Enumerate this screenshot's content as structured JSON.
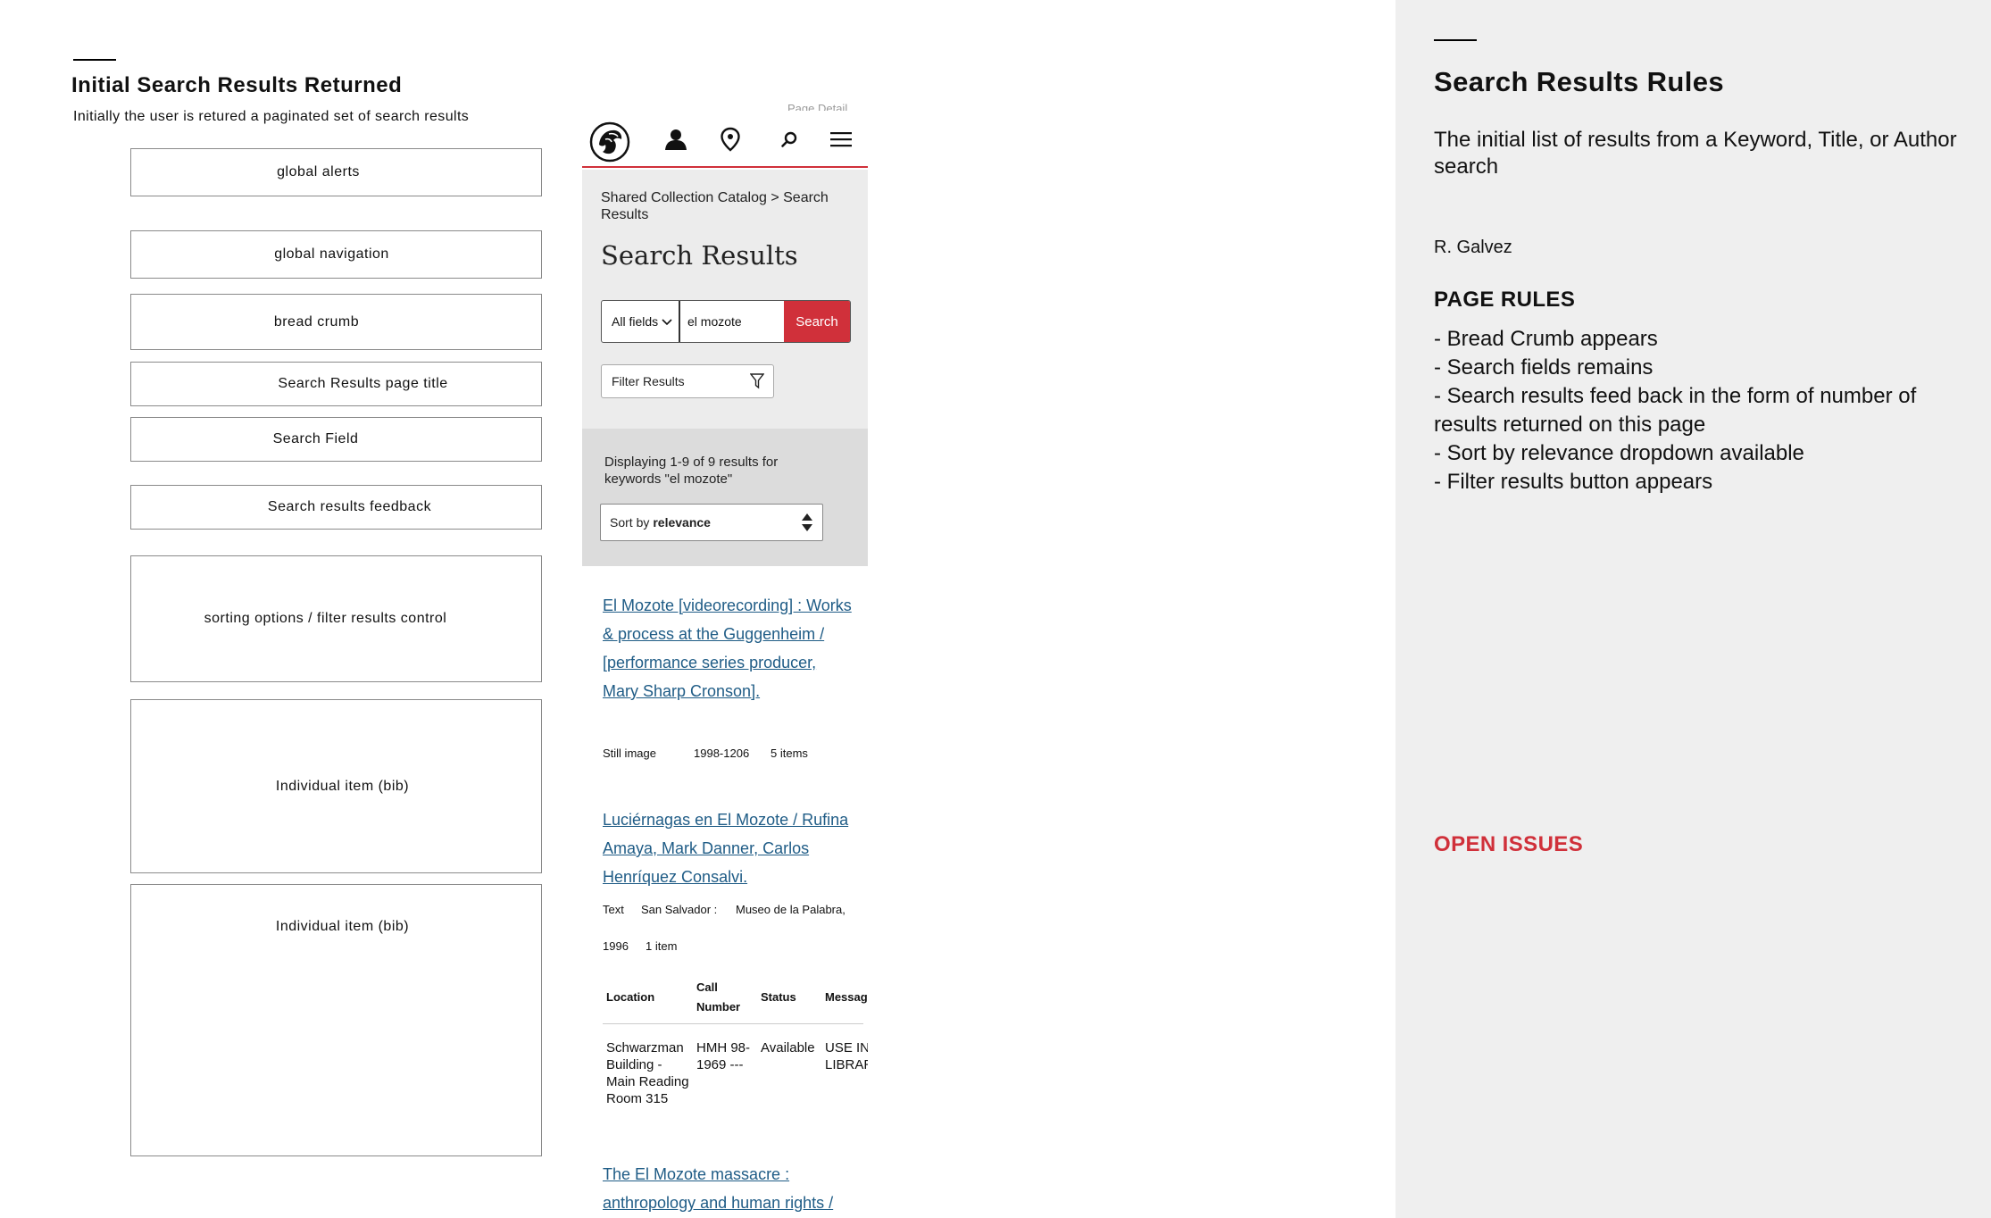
{
  "wireframe": {
    "title": "Initial Search Results Returned",
    "subtitle": "Initially the user is retured a paginated set of search results",
    "boxes": [
      "global alerts",
      "global navigation",
      "bread crumb",
      "Search Results page title",
      "Search Field",
      "Search results feedback",
      "sorting options / filter results control",
      "Individual item (bib)",
      "Individual item (bib)"
    ]
  },
  "mock": {
    "page_detail": "Page Detail",
    "header_icons": [
      "lion-logo-icon",
      "user-icon",
      "location-pin-icon",
      "search-icon",
      "menu-icon"
    ],
    "breadcrumb": "Shared Collection Catalog > Search Results",
    "page_title": "Search Results",
    "search": {
      "field_select": "All fields",
      "query": "el mozote",
      "button": "Search"
    },
    "filter_button": "Filter Results",
    "feedback": "Displaying 1-9 of 9 results for keywords \"el mozote\"",
    "sort": {
      "prefix": "Sort by",
      "value": "relevance"
    },
    "results": [
      {
        "title": "El Mozote [videorecording] : Works & process at the Guggenheim / [performance series producer, Mary Sharp Cronson].",
        "type": "Still image",
        "date": "1998-1206",
        "items": "5 items"
      },
      {
        "title": "Luciérnagas en El Mozote / Rufina Amaya, Mark Danner, Carlos Henríquez Consalvi.",
        "type": "Text",
        "place": "San Salvador :",
        "publisher": "Museo de la Palabra,",
        "date": "1996",
        "items": "1 item",
        "table": {
          "headers": [
            "Location",
            "Call Number",
            "Status",
            "Message"
          ],
          "row": [
            "Schwarzman Building - Main Reading Room 315",
            "HMH 98-1969 ---",
            "Available",
            "USE IN LIBRARY"
          ]
        }
      },
      {
        "title": "The El Mozote massacre : anthropology and human rights /"
      }
    ]
  },
  "panel": {
    "title": "Search Results Rules",
    "description": "The initial list of results from a Keyword, Title, or Author search",
    "author": "R. Galvez",
    "page_rules_heading": "PAGE RULES",
    "rules": [
      "- Bread Crumb appears",
      "- Search fields remains",
      "- Search results feed back in the form of number of results returned on this page",
      "- Sort by relevance dropdown available",
      "- Filter results button appears"
    ],
    "open_issues_heading": "OPEN ISSUES"
  },
  "colors": {
    "brand_red": "#d0303a",
    "link_blue": "#1f5c86",
    "panel_bg": "#efefef",
    "mock_gray": "#ececec"
  }
}
